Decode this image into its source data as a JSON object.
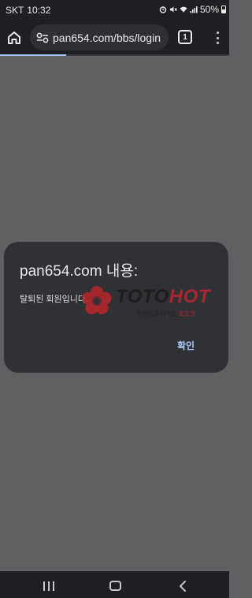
{
  "status_bar": {
    "carrier": "SKT",
    "time": "10:32",
    "battery": "50%",
    "icons": [
      "alarm-icon",
      "mute-icon",
      "wifi-icon",
      "signal-icon",
      "battery-icon"
    ]
  },
  "browser": {
    "url": "pan654.com/bbs/login",
    "tab_count": "1",
    "load_progress": 0.29
  },
  "dialog": {
    "title": "pan654.com 내용:",
    "message": "탈퇴된 회원입니다.",
    "ok_label": "확인"
  },
  "watermark": {
    "brand_part1": "TOTO",
    "brand_part2": "HOT",
    "sub_part1": "먹튀검증사이트 ",
    "sub_part2": "토토핫",
    "colors": {
      "dark": "#1a1a1a",
      "red": "#c4262e"
    }
  },
  "colors": {
    "overlay": "#5f6062",
    "dialog": "#303135",
    "accent": "#a8c7fa",
    "chrome": "#1f2023"
  },
  "nav": {
    "icons": [
      "recents-icon",
      "home-icon",
      "back-icon"
    ]
  }
}
